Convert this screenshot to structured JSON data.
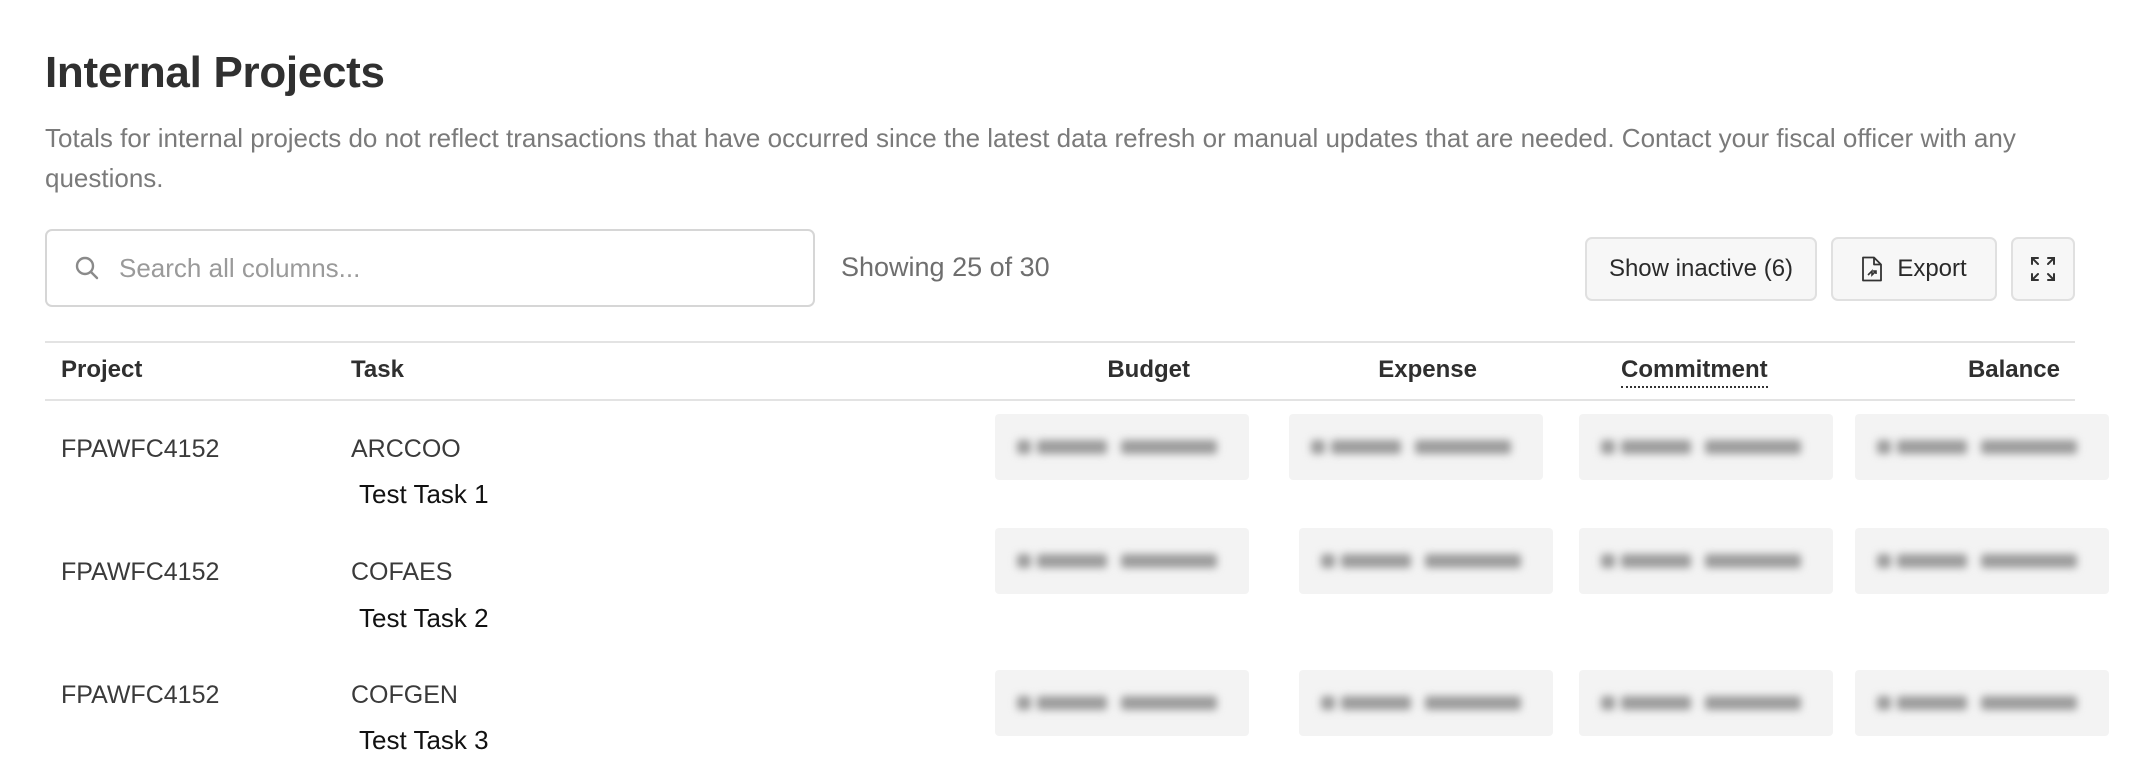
{
  "header": {
    "title": "Internal Projects",
    "description": "Totals for internal projects do not reflect transactions that have occurred since the latest data refresh or manual updates that are needed. Contact your fiscal officer with any questions."
  },
  "toolbar": {
    "search_placeholder": "Search all columns...",
    "search_value": "",
    "row_count": "Showing 25 of 30",
    "show_inactive_label": "Show inactive (6)",
    "export_label": "Export",
    "icons": {
      "search": "search-icon",
      "export": "file-export-icon",
      "expand": "expand-icon"
    }
  },
  "table": {
    "columns": [
      "Project",
      "Task",
      "Budget",
      "Expense",
      "Commitment",
      "Balance"
    ],
    "rows": [
      {
        "project": "FPAWFC4152",
        "task": "ARCCOO",
        "task_description": "Test Task 1"
      },
      {
        "project": "FPAWFC4152",
        "task": "COFAES",
        "task_description": "Test Task 2"
      },
      {
        "project": "FPAWFC4152",
        "task": "COFGEN",
        "task_description": "Test Task 3"
      }
    ]
  }
}
